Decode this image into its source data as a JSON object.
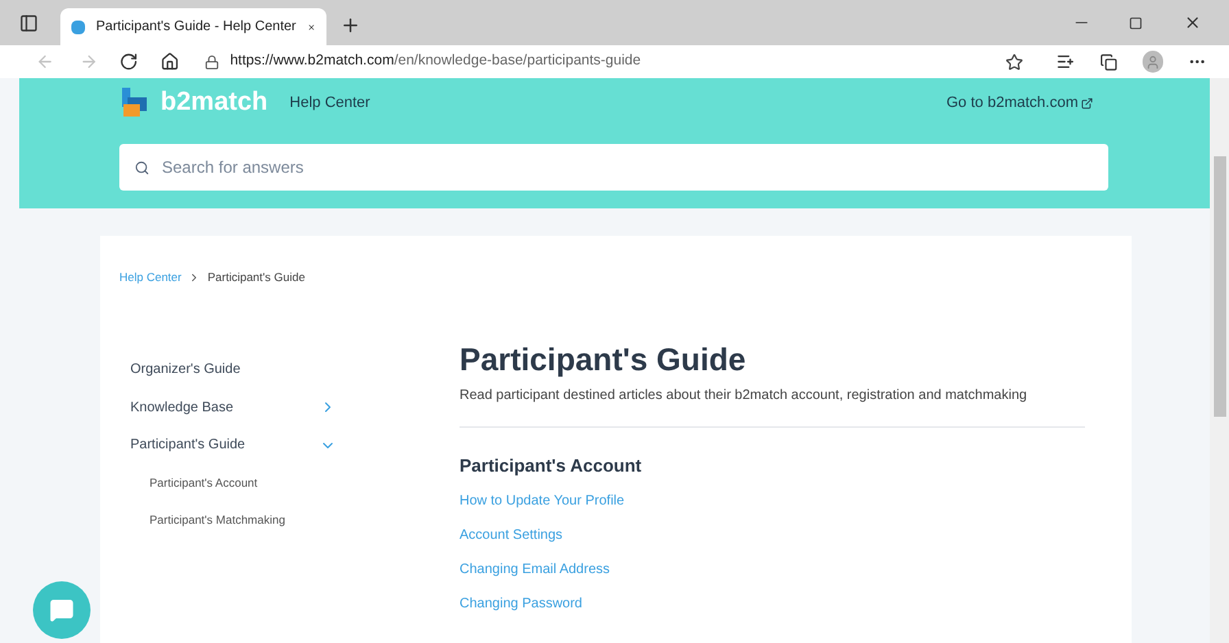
{
  "browser": {
    "tab": {
      "title": "Participant's Guide - Help Center",
      "selected": true
    },
    "url_host": "https://www.b2match.com",
    "url_path": "/en/knowledge-base/participants-guide"
  },
  "header": {
    "logo": "b2match",
    "subtitle": "Help Center",
    "external_link": "Go to b2match.com",
    "search": {
      "placeholder": "Search for answers"
    }
  },
  "breadcrumb": [
    {
      "label": "Help Center"
    },
    {
      "label": "Participant's Guide"
    }
  ],
  "sidebar": {
    "items": [
      {
        "label": "Organizer's Guide",
        "kind": "link"
      },
      {
        "label": "Knowledge Base",
        "kind": "group",
        "expanded": false
      },
      {
        "label": "Participant's Guide",
        "kind": "group",
        "expanded": true,
        "children": [
          {
            "label": "Participant's Account"
          },
          {
            "label": "Participant's Matchmaking"
          }
        ]
      }
    ]
  },
  "article": {
    "title": "Participant's Guide",
    "description": "Read participant destined articles about their b2match account, registration and matchmaking",
    "sections": [
      {
        "title": "Participant's Account",
        "links": [
          "How to Update Your Profile",
          "Account Settings",
          "Changing Email Address",
          "Changing Password"
        ]
      }
    ]
  }
}
